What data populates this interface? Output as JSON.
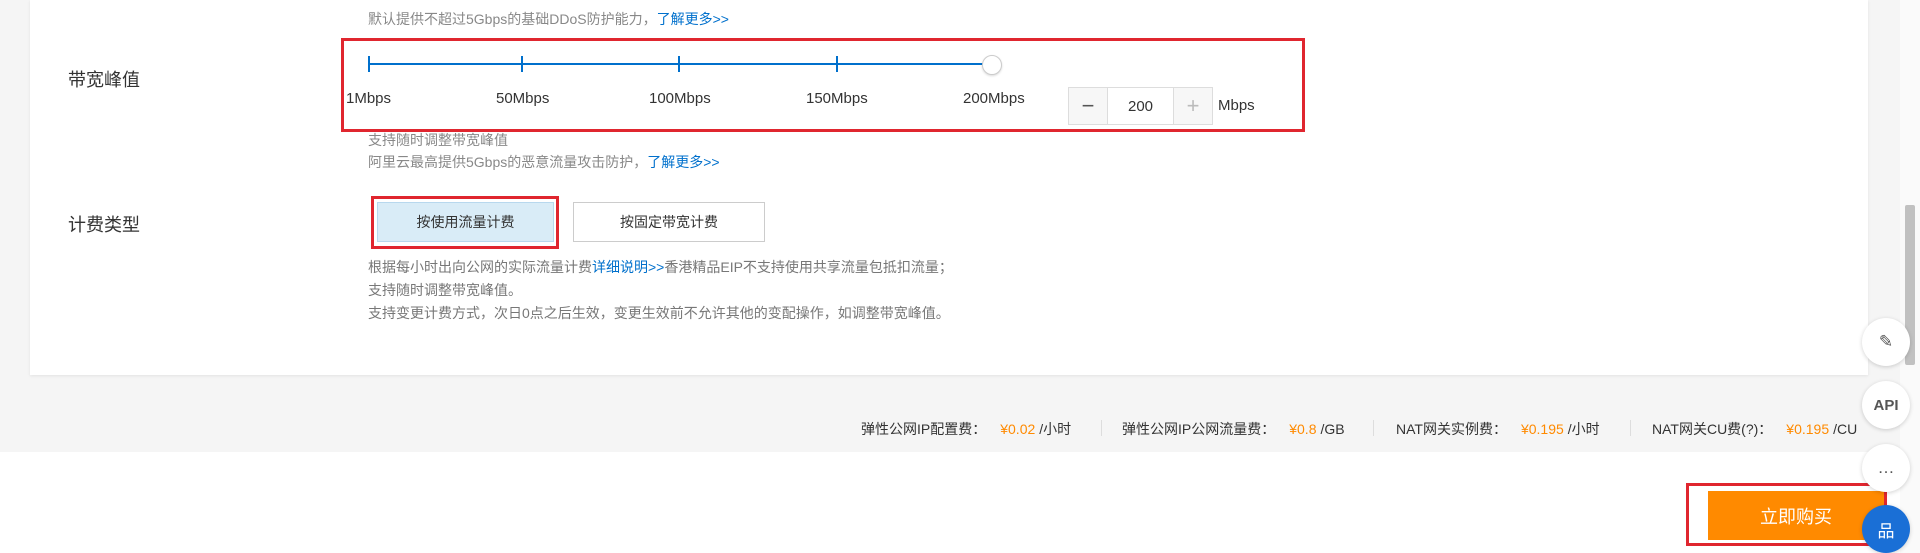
{
  "ddos_note": {
    "text": "默认提供不超过5Gbps的基础DDoS防护能力，",
    "link": "了解更多>>"
  },
  "bandwidth": {
    "label": "带宽峰值",
    "ticks": [
      "1Mbps",
      "50Mbps",
      "100Mbps",
      "150Mbps",
      "200Mbps"
    ],
    "value": "200",
    "unit": "Mbps",
    "minus": "−",
    "plus": "+",
    "note1": "支持随时调整带宽峰值",
    "note2_text": "阿里云最高提供5Gbps的恶意流量攻击防护，",
    "note2_link": "了解更多>>"
  },
  "billing": {
    "label": "计费类型",
    "options": [
      "按使用流量计费",
      "按固定带宽计费"
    ],
    "selected": "按使用流量计费",
    "desc1_pre": "根据每小时出向公网的实际流量计费",
    "desc1_link": "详细说明>>",
    "desc1_post": "香港精品EIP不支持使用共享流量包抵扣流量；",
    "desc2": "支持随时调整带宽峰值。",
    "desc3": "支持变更计费方式，次日0点之后生效，变更生效前不允许其他的变配操作，如调整带宽峰值。"
  },
  "fees": [
    {
      "label": "弹性公网IP配置费：",
      "price": "¥0.02",
      "per": "/小时"
    },
    {
      "label": "弹性公网IP公网流量费：",
      "price": "¥0.8",
      "per": "/GB"
    },
    {
      "label": "NAT网关实例费：",
      "price": "¥0.195",
      "per": "/小时"
    },
    {
      "label": "NAT网关CU费(?)：",
      "price": "¥0.195",
      "per": "/CU"
    }
  ],
  "buy_label": "立即购买",
  "float": {
    "api": "API",
    "feedback": "✎",
    "chat": "…",
    "grid": "品"
  },
  "colors": {
    "accent": "#0070cc",
    "price": "#ff8a00",
    "buy": "#ff8a00",
    "highlight": "#e0262f"
  }
}
